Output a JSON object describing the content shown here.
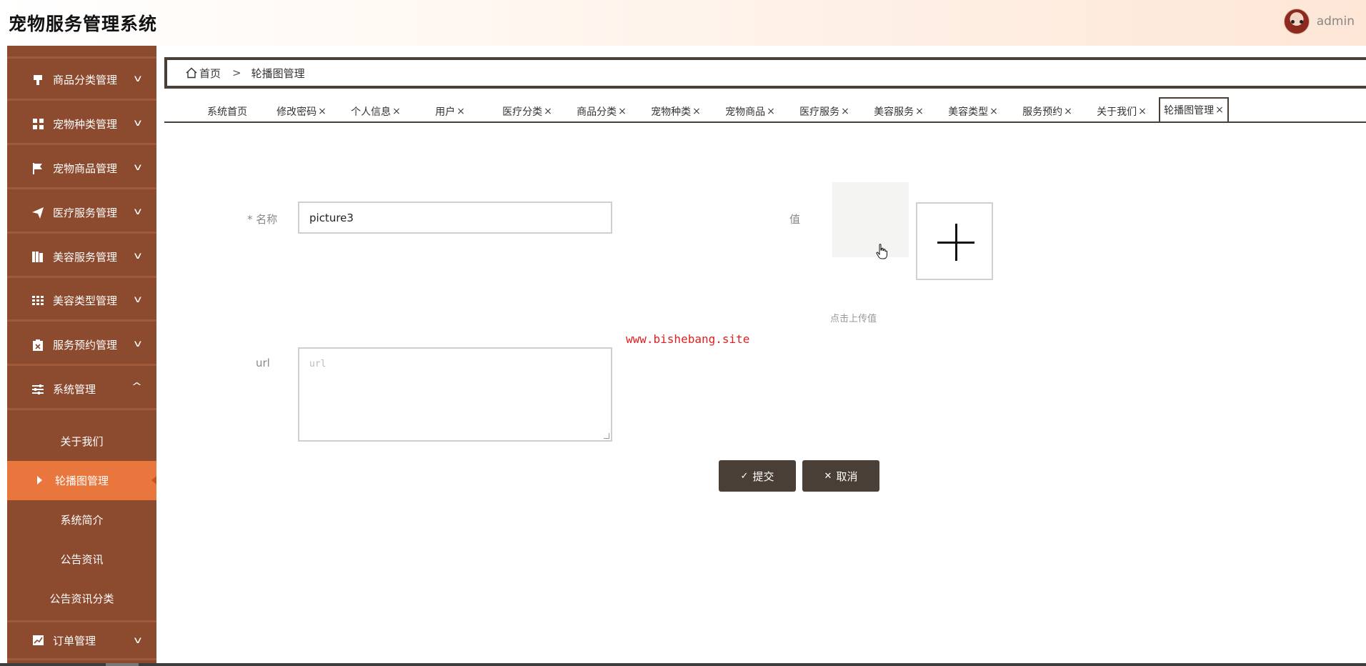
{
  "header": {
    "title": "宠物服务管理系统",
    "username": "admin"
  },
  "sidebar": {
    "items": [
      {
        "label": "商品分类管理",
        "icon": "stamp-icon"
      },
      {
        "label": "宠物种类管理",
        "icon": "grid-icon"
      },
      {
        "label": "宠物商品管理",
        "icon": "flag-icon"
      },
      {
        "label": "医疗服务管理",
        "icon": "paper-plane-icon"
      },
      {
        "label": "美容服务管理",
        "icon": "book-icon"
      },
      {
        "label": "美容类型管理",
        "icon": "table-grid-icon"
      },
      {
        "label": "服务预约管理",
        "icon": "clipboard-x-icon"
      },
      {
        "label": "系统管理",
        "icon": "sliders-icon",
        "expanded": true
      }
    ],
    "sub_items": [
      {
        "label": "关于我们"
      },
      {
        "label": "轮播图管理",
        "active": true
      },
      {
        "label": "系统简介"
      },
      {
        "label": "公告资讯"
      },
      {
        "label": "公告资讯分类"
      }
    ],
    "last_item": {
      "label": "订单管理",
      "icon": "chart-line-icon"
    }
  },
  "breadcrumb": {
    "home": "首页",
    "separator": ">",
    "current": "轮播图管理"
  },
  "tabs": [
    {
      "label": "系统首页",
      "closable": false
    },
    {
      "label": "修改密码",
      "closable": true
    },
    {
      "label": "个人信息",
      "closable": true
    },
    {
      "label": "用户",
      "closable": true
    },
    {
      "label": "医疗分类",
      "closable": true
    },
    {
      "label": "商品分类",
      "closable": true
    },
    {
      "label": "宠物种类",
      "closable": true
    },
    {
      "label": "宠物商品",
      "closable": true
    },
    {
      "label": "医疗服务",
      "closable": true
    },
    {
      "label": "美容服务",
      "closable": true
    },
    {
      "label": "美容类型",
      "closable": true
    },
    {
      "label": "服务预约",
      "closable": true
    },
    {
      "label": "关于我们",
      "closable": true
    },
    {
      "label": "轮播图管理",
      "closable": true,
      "active": true
    }
  ],
  "tab_close_glyph": "×",
  "form": {
    "name_label": "* 名称",
    "name_value": "picture3",
    "value_label": "值",
    "upload_hint": "点击上传值",
    "url_label": "url",
    "url_placeholder": "url",
    "submit_label": "提交",
    "cancel_label": "取消"
  },
  "watermark": "www.bishebang.site",
  "colors": {
    "sidebar_bg": "#8c4a2e",
    "sidebar_active": "#e9763c",
    "button_bg": "#4a3f37",
    "watermark": "#e02020"
  }
}
